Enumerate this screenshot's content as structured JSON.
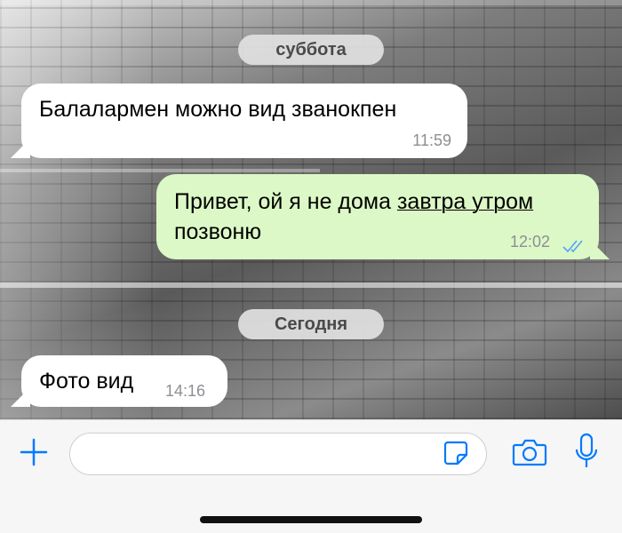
{
  "conversation": {
    "date_separators": [
      "суббота",
      "Сегодня"
    ],
    "messages": [
      {
        "direction": "incoming",
        "text": "Балалармен можно вид званокпен",
        "time": "11:59"
      },
      {
        "direction": "outgoing",
        "text_line1_a": "Привет, ой я не дома ",
        "text_line1_link": "завтра утром",
        "text_line2": "позвоню",
        "time": "12:02",
        "status": "read"
      },
      {
        "direction": "incoming",
        "text": "Фото вид",
        "time": "14:16"
      }
    ]
  },
  "input_bar": {
    "message_value": "",
    "icons": [
      "plus-icon",
      "sticker-icon",
      "camera-icon",
      "microphone-icon"
    ]
  },
  "colors": {
    "accent": "#007aff",
    "outgoing_bubble": "#dcf8c6",
    "incoming_bubble": "#ffffff"
  }
}
